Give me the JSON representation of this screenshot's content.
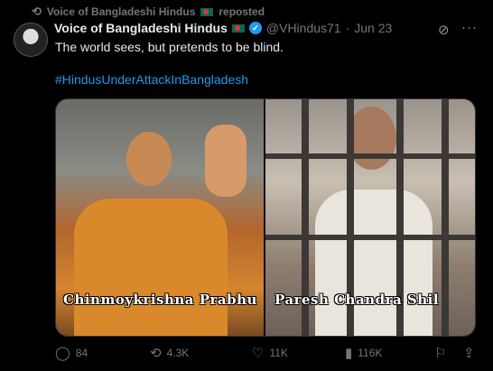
{
  "repost": {
    "label": "Voice of Bangladeshi Hindus",
    "suffix": "reposted"
  },
  "post": {
    "display_name": "Voice of Bangladeshi Hindus",
    "handle": "@VHindus71",
    "separator": "·",
    "date": "Jun 23",
    "text": "The world sees, but pretends to be blind.",
    "hashtag": "#HindusUnderAttackInBangladesh"
  },
  "media": {
    "caption_left": "Chinmoykrishna Prabhu",
    "caption_right": "Paresh Chandra Shil"
  },
  "actions": {
    "replies": "84",
    "reposts": "4.3K",
    "likes": "11K",
    "views": "116K"
  },
  "colors": {
    "accent": "#1d9bf0",
    "muted": "#71767b",
    "background": "#000000"
  }
}
